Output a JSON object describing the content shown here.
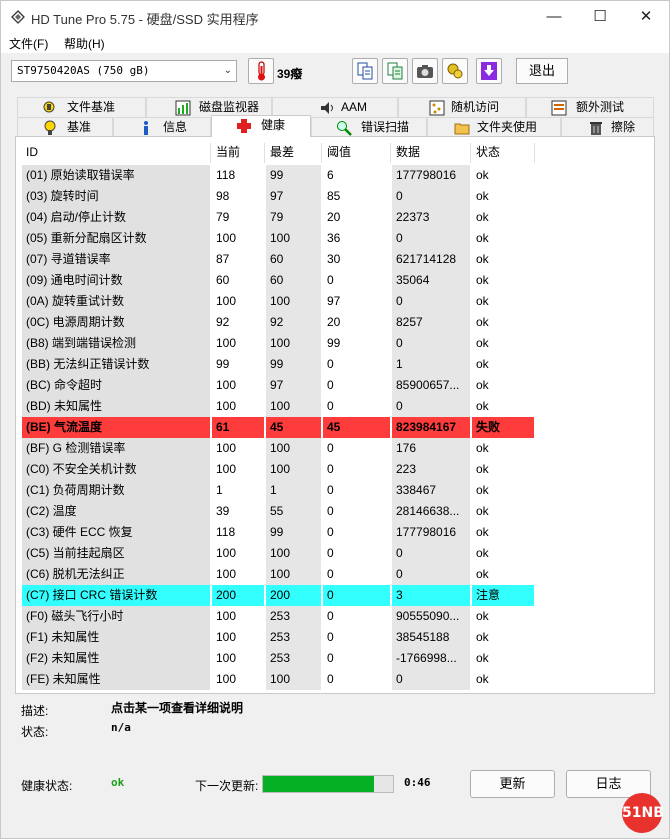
{
  "window": {
    "title": "HD Tune Pro 5.75 - 硬盘/SSD 实用程序",
    "minimize": "—",
    "maximize": "☐",
    "close": "✕"
  },
  "menu": {
    "file": "文件(F)",
    "help": "帮助(H)"
  },
  "toolbar": {
    "drive": "ST9750420AS (750 gB)",
    "temperature": "39癈",
    "exit_label": "退出"
  },
  "tabs": {
    "row1": [
      "文件基准",
      "磁盘监视器",
      "AAM",
      "随机访问",
      "额外测试"
    ],
    "row2": [
      "基准",
      "信息",
      "健康",
      "错误扫描",
      "文件夹使用",
      "擦除"
    ],
    "active": "健康"
  },
  "table": {
    "headers": [
      "ID",
      "当前",
      "最差",
      "阈值",
      "数据",
      "状态"
    ],
    "rows": [
      [
        "(01) 原始读取错误率",
        "118",
        "99",
        "6",
        "177798016",
        "ok"
      ],
      [
        "(03) 旋转时间",
        "98",
        "97",
        "85",
        "0",
        "ok"
      ],
      [
        "(04) 启动/停止计数",
        "79",
        "79",
        "20",
        "22373",
        "ok"
      ],
      [
        "(05) 重新分配扇区计数",
        "100",
        "100",
        "36",
        "0",
        "ok"
      ],
      [
        "(07) 寻道错误率",
        "87",
        "60",
        "30",
        "621714128",
        "ok"
      ],
      [
        "(09) 通电时间计数",
        "60",
        "60",
        "0",
        "35064",
        "ok"
      ],
      [
        "(0A) 旋转重试计数",
        "100",
        "100",
        "97",
        "0",
        "ok"
      ],
      [
        "(0C) 电源周期计数",
        "92",
        "92",
        "20",
        "8257",
        "ok"
      ],
      [
        "(B8) 端到端错误检测",
        "100",
        "100",
        "99",
        "0",
        "ok"
      ],
      [
        "(BB) 无法纠正错误计数",
        "99",
        "99",
        "0",
        "1",
        "ok"
      ],
      [
        "(BC) 命令超时",
        "100",
        "97",
        "0",
        "85900657...",
        "ok"
      ],
      [
        "(BD) 未知属性",
        "100",
        "100",
        "0",
        "0",
        "ok"
      ],
      [
        "(BE) 气流温度",
        "61",
        "45",
        "45",
        "823984167",
        "失败"
      ],
      [
        "(BF) G 检测错误率",
        "100",
        "100",
        "0",
        "176",
        "ok"
      ],
      [
        "(C0) 不安全关机计数",
        "100",
        "100",
        "0",
        "223",
        "ok"
      ],
      [
        "(C1) 负荷周期计数",
        "1",
        "1",
        "0",
        "338467",
        "ok"
      ],
      [
        "(C2) 温度",
        "39",
        "55",
        "0",
        "28146638...",
        "ok"
      ],
      [
        "(C3) 硬件 ECC 恢复",
        "118",
        "99",
        "0",
        "177798016",
        "ok"
      ],
      [
        "(C5) 当前挂起扇区",
        "100",
        "100",
        "0",
        "0",
        "ok"
      ],
      [
        "(C6) 脱机无法纠正",
        "100",
        "100",
        "0",
        "0",
        "ok"
      ],
      [
        "(C7) 接口 CRC 错误计数",
        "200",
        "200",
        "0",
        "3",
        "注意"
      ],
      [
        "(F0) 磁头飞行小时",
        "100",
        "253",
        "0",
        "90555090...",
        "ok"
      ],
      [
        "(F1) 未知属性",
        "100",
        "253",
        "0",
        "38545188",
        "ok"
      ],
      [
        "(F2) 未知属性",
        "100",
        "253",
        "0",
        "-1766998...",
        "ok"
      ],
      [
        "(FE) 未知属性",
        "100",
        "100",
        "0",
        "0",
        "ok"
      ]
    ],
    "highlight": {
      "failed_row": 12,
      "warning_row": 20,
      "failed_color": "#ff3c3c",
      "warning_color": "#33ffff"
    }
  },
  "details": {
    "desc_label": "描述:",
    "desc_value": "点击某一项查看详细说明",
    "status_label": "状态:",
    "status_value": "n/a"
  },
  "footer": {
    "health_label": "健康状态:",
    "health_value": "ok",
    "next_update_label": "下一次更新:",
    "progress_fraction": 0.85,
    "countdown": "0:46",
    "refresh_label": "更新",
    "log_label": "日志",
    "watermark": "51NB"
  },
  "icons": {
    "app": "hdtune-icon",
    "temperature": "thermometer-icon",
    "toolbar_buttons": [
      "copy-text-icon",
      "copy-info-icon",
      "screenshot-icon",
      "options-icon",
      "save-icon"
    ]
  }
}
